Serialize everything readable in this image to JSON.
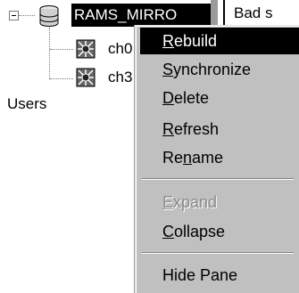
{
  "tree": {
    "root_label": "RAMS_MIRRO",
    "children": [
      {
        "label": "ch0"
      },
      {
        "label": "ch3"
      }
    ],
    "sibling_label": "Users"
  },
  "right_pane": {
    "partial_text": "Bad s"
  },
  "context_menu": {
    "items": [
      {
        "label": "Rebuild",
        "state": "highlighted"
      },
      {
        "label": "Synchronize",
        "state": "enabled"
      },
      {
        "label": "Delete",
        "state": "enabled"
      },
      {
        "label": "Refresh",
        "state": "enabled"
      },
      {
        "label": "Rename",
        "state": "enabled"
      },
      {
        "label": "Expand",
        "state": "disabled"
      },
      {
        "label": "Collapse",
        "state": "enabled"
      },
      {
        "label": "Hide Pane",
        "state": "enabled"
      }
    ]
  },
  "colors": {
    "menu_background": "#c0c0c0",
    "highlight": "#000000",
    "disabled_text": "#8a8a8a"
  },
  "icons": [
    "collapse-icon",
    "database-icon",
    "channel-icon"
  ]
}
